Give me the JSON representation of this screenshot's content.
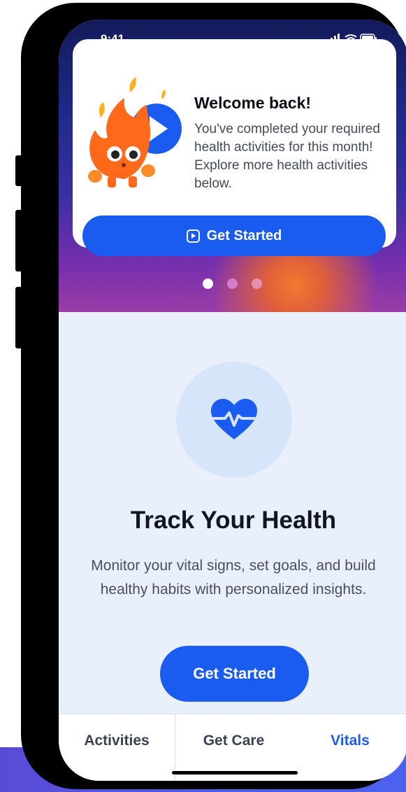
{
  "status_bar": {
    "time": "9:41",
    "icons": [
      "cellular-icon",
      "wifi-icon",
      "battery-icon"
    ]
  },
  "welcome_card": {
    "title": "Welcome back!",
    "body": "You've completed your required health activities for this month! Explore more health activities below.",
    "button_label": "Get Started",
    "button_icon": "play-square-icon",
    "mascot": "flame-mascot-with-play-icon"
  },
  "carousel": {
    "page_count": 3,
    "active_index": 0
  },
  "track_section": {
    "icon": "heart-pulse-icon",
    "title": "Track Your Health",
    "body": "Monitor your vital signs, set goals, and build healthy habits with personalized insights.",
    "button_label": "Get Started"
  },
  "tabs": [
    {
      "label": "Activities",
      "active": false
    },
    {
      "label": "Get Care",
      "active": false
    },
    {
      "label": "Vitals",
      "active": true
    }
  ],
  "colors": {
    "accent": "#1a5cf0",
    "tab_active": "#1a5cf0",
    "tab_inactive": "#3c4150",
    "content_background": "#eaf0fb",
    "icon_circle": "#d7e5fa"
  }
}
